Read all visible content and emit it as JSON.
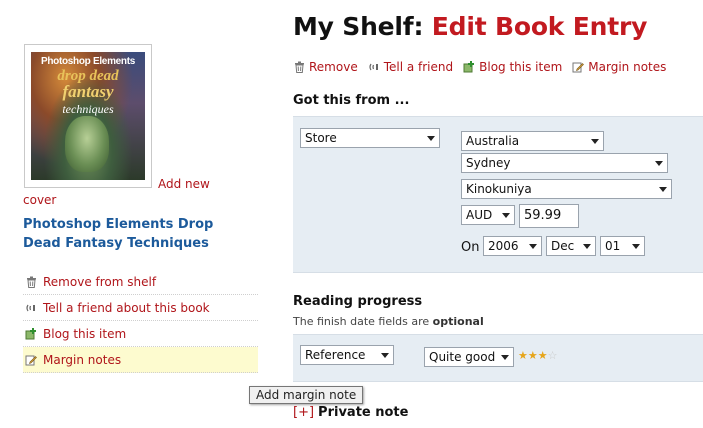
{
  "cover": {
    "line1": "Photoshop Elements",
    "line2": "drop dead",
    "line3": "fantasy",
    "line4": "techniques"
  },
  "add_cover": {
    "part1": "Add new",
    "part2": "cover"
  },
  "book_title": "Photoshop Elements Drop Dead Fantasy Techniques",
  "side_menu": [
    {
      "label": "Remove from shelf",
      "icon": "trash-icon"
    },
    {
      "label": "Tell a friend about this book",
      "icon": "broadcast-icon"
    },
    {
      "label": "Blog this item",
      "icon": "blog-plus-icon"
    },
    {
      "label": "Margin notes",
      "icon": "note-pencil-icon"
    }
  ],
  "tooltip": "Add margin note",
  "header": {
    "prefix": "My Shelf:",
    "accent": "Edit Book Entry"
  },
  "actions": [
    {
      "label": "Remove",
      "icon": "trash-icon"
    },
    {
      "label": "Tell a friend",
      "icon": "broadcast-icon"
    },
    {
      "label": "Blog this item",
      "icon": "blog-plus-icon"
    },
    {
      "label": "Margin notes",
      "icon": "note-pencil-icon"
    }
  ],
  "got_from": {
    "heading": "Got this from ...",
    "source": "Store",
    "country": "Australia",
    "city": "Sydney",
    "store": "Kinokuniya",
    "currency": "AUD",
    "price": "59.99",
    "on_label": "On",
    "year": "2006",
    "month": "Dec",
    "day": "01"
  },
  "reading": {
    "heading": "Reading progress",
    "sub_prefix": "The finish date fields are",
    "sub_bold": "optional",
    "status": "Reference",
    "rating_label": "Quite good",
    "rating": 3,
    "rating_max": 4
  },
  "private_note": {
    "toggle": "[+]",
    "label": "Private note"
  },
  "colors": {
    "accent": "#c21a20",
    "link": "#b0151a",
    "title_blue": "#1c5a9b",
    "panel": "#e6edf3"
  }
}
